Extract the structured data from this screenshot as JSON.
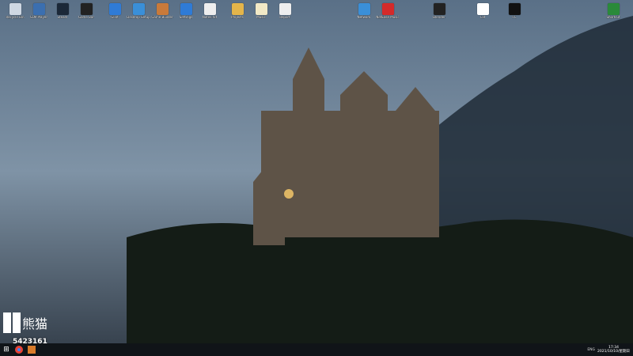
{
  "desktop": {
    "icons": [
      {
        "label": "Recycle Bin",
        "color": "#cfd8e3",
        "name": "recycle-bin-icon"
      },
      {
        "label": "SLM Player",
        "color": "#3b6fb0",
        "name": "app-icon"
      },
      {
        "label": "Steam",
        "color": "#1b2838",
        "name": "steam-icon"
      },
      {
        "label": "Game Bar",
        "color": "#222222",
        "name": "app-icon"
      },
      {
        "label": "Glint",
        "color": "#2f7bd6",
        "name": "app-icon"
      },
      {
        "label": "Desktop Setup",
        "color": "#3a8fd8",
        "name": "app-icon"
      },
      {
        "label": "Game Builder",
        "color": "#c97a3a",
        "name": "app-icon"
      },
      {
        "label": "Settings",
        "color": "#2f7bd6",
        "name": "app-icon"
      },
      {
        "label": "Notes.txt",
        "color": "#eeeeee",
        "name": "text-file-icon"
      },
      {
        "label": "Projects",
        "color": "#e4b54a",
        "name": "folder-icon"
      },
      {
        "label": "Music",
        "color": "#f2e9c6",
        "name": "file-icon"
      },
      {
        "label": "Report",
        "color": "#eeeeee",
        "name": "text-file-icon"
      },
      {
        "label": "Network",
        "color": "#3a8fd8",
        "name": "network-icon"
      },
      {
        "label": "NetEase Music",
        "color": "#d42a2a",
        "name": "netease-music-icon"
      },
      {
        "label": "Blender",
        "color": "#222222",
        "name": "app-icon"
      },
      {
        "label": "Cat",
        "color": "#ffffff",
        "name": "app-icon"
      },
      {
        "label": "FC",
        "color": "#111111",
        "name": "app-icon"
      },
      {
        "label": "Shortcut",
        "color": "#2a8a3a",
        "name": "app-icon"
      }
    ]
  },
  "stream": {
    "logo_text": "熊猫",
    "number": "5423161"
  },
  "taskbar": {
    "start_label": "⊞",
    "clock_time": "17:34",
    "clock_date": "2021/10/10/星期日",
    "tray_lang": "ENG"
  }
}
